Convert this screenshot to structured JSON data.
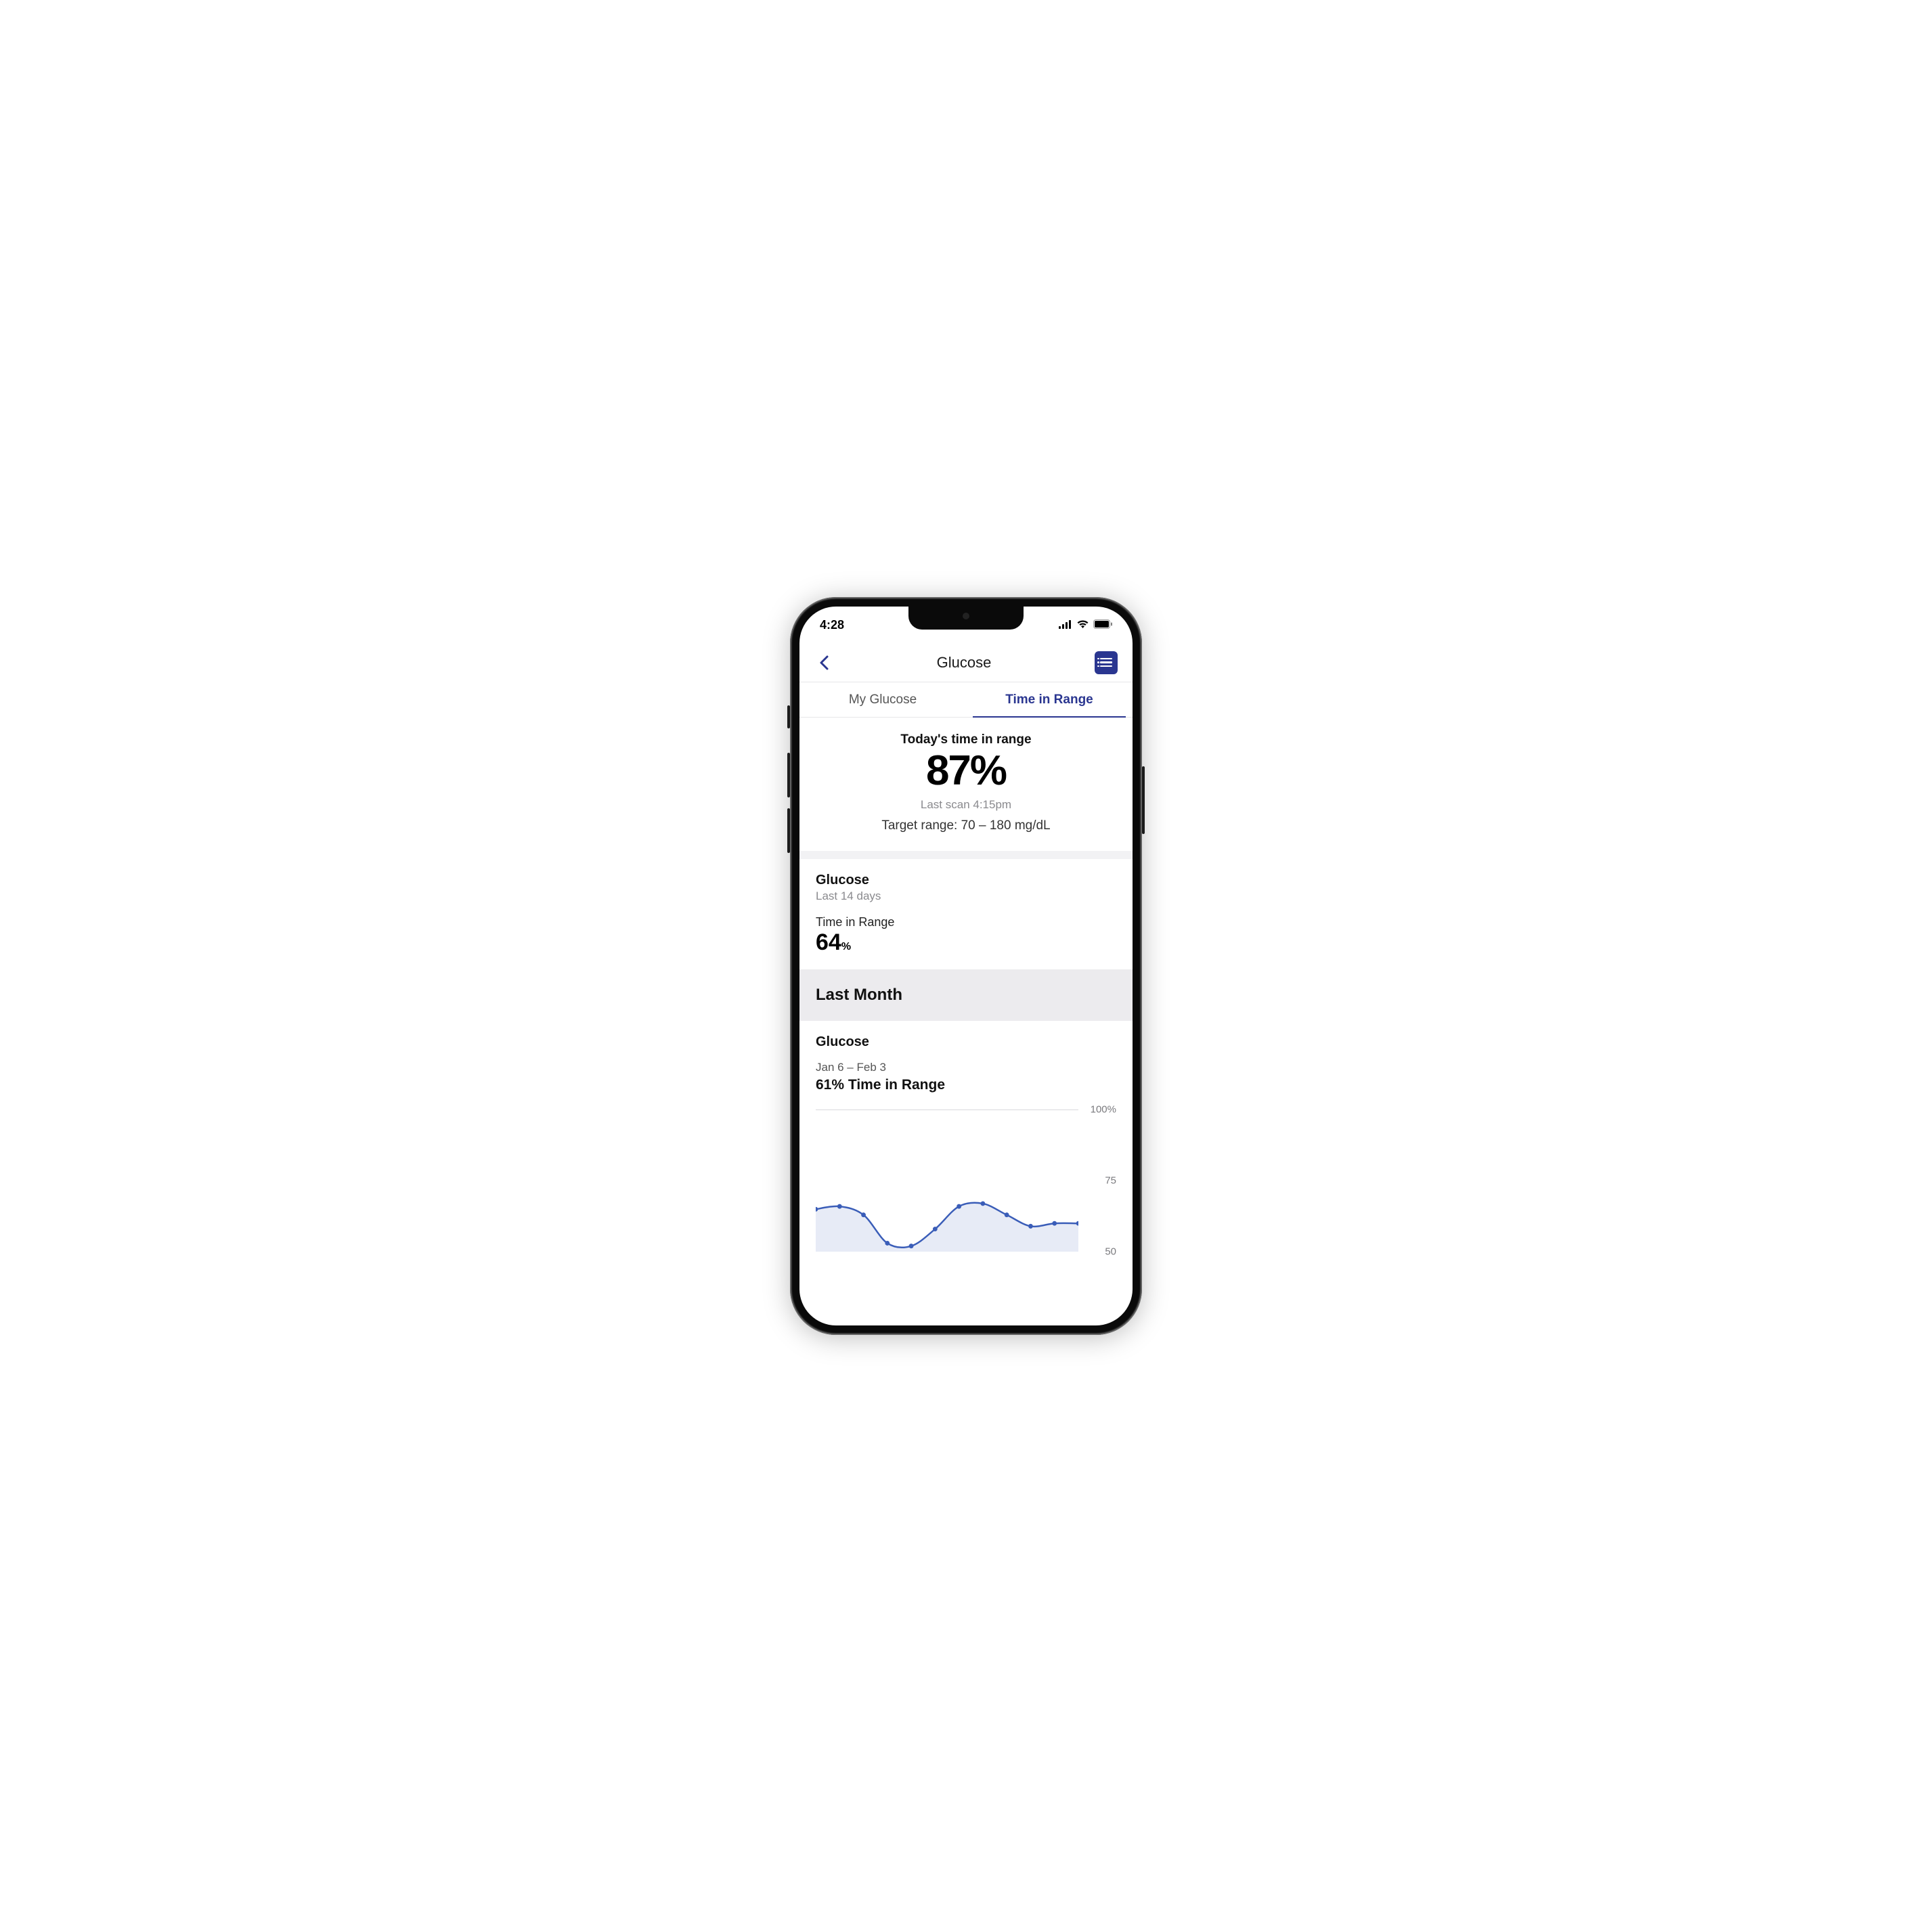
{
  "statusbar": {
    "time": "4:28"
  },
  "header": {
    "title": "Glucose"
  },
  "tabs": {
    "left": "My Glucose",
    "right": "Time in Range",
    "active": "right"
  },
  "today": {
    "label": "Today's time in range",
    "value": "87%",
    "last_scan": "Last scan 4:15pm",
    "target_range": "Target range: 70 – 180 mg/dL"
  },
  "fourteen_day": {
    "title": "Glucose",
    "subtitle": "Last 14 days",
    "metric_label": "Time in Range",
    "metric_value": "64",
    "metric_unit": "%"
  },
  "last_month_header": "Last Month",
  "last_month": {
    "title": "Glucose",
    "date_range": "Jan 6 – Feb 3",
    "tir_label": "61% Time in Range"
  },
  "chart_data": {
    "type": "line",
    "ylabel": "",
    "ylim": [
      0,
      100
    ],
    "y_ticks": [
      50,
      75,
      100
    ],
    "y_tick_labels": [
      "50",
      "75",
      "100%"
    ],
    "x": [
      1,
      2,
      3,
      4,
      5,
      6,
      7,
      8,
      9,
      10
    ],
    "values": [
      65,
      66,
      63,
      53,
      52,
      58,
      66,
      67,
      63,
      59,
      60,
      60
    ],
    "series_color": "#3a5db8",
    "fill_color": "rgba(58,93,184,0.12)"
  }
}
